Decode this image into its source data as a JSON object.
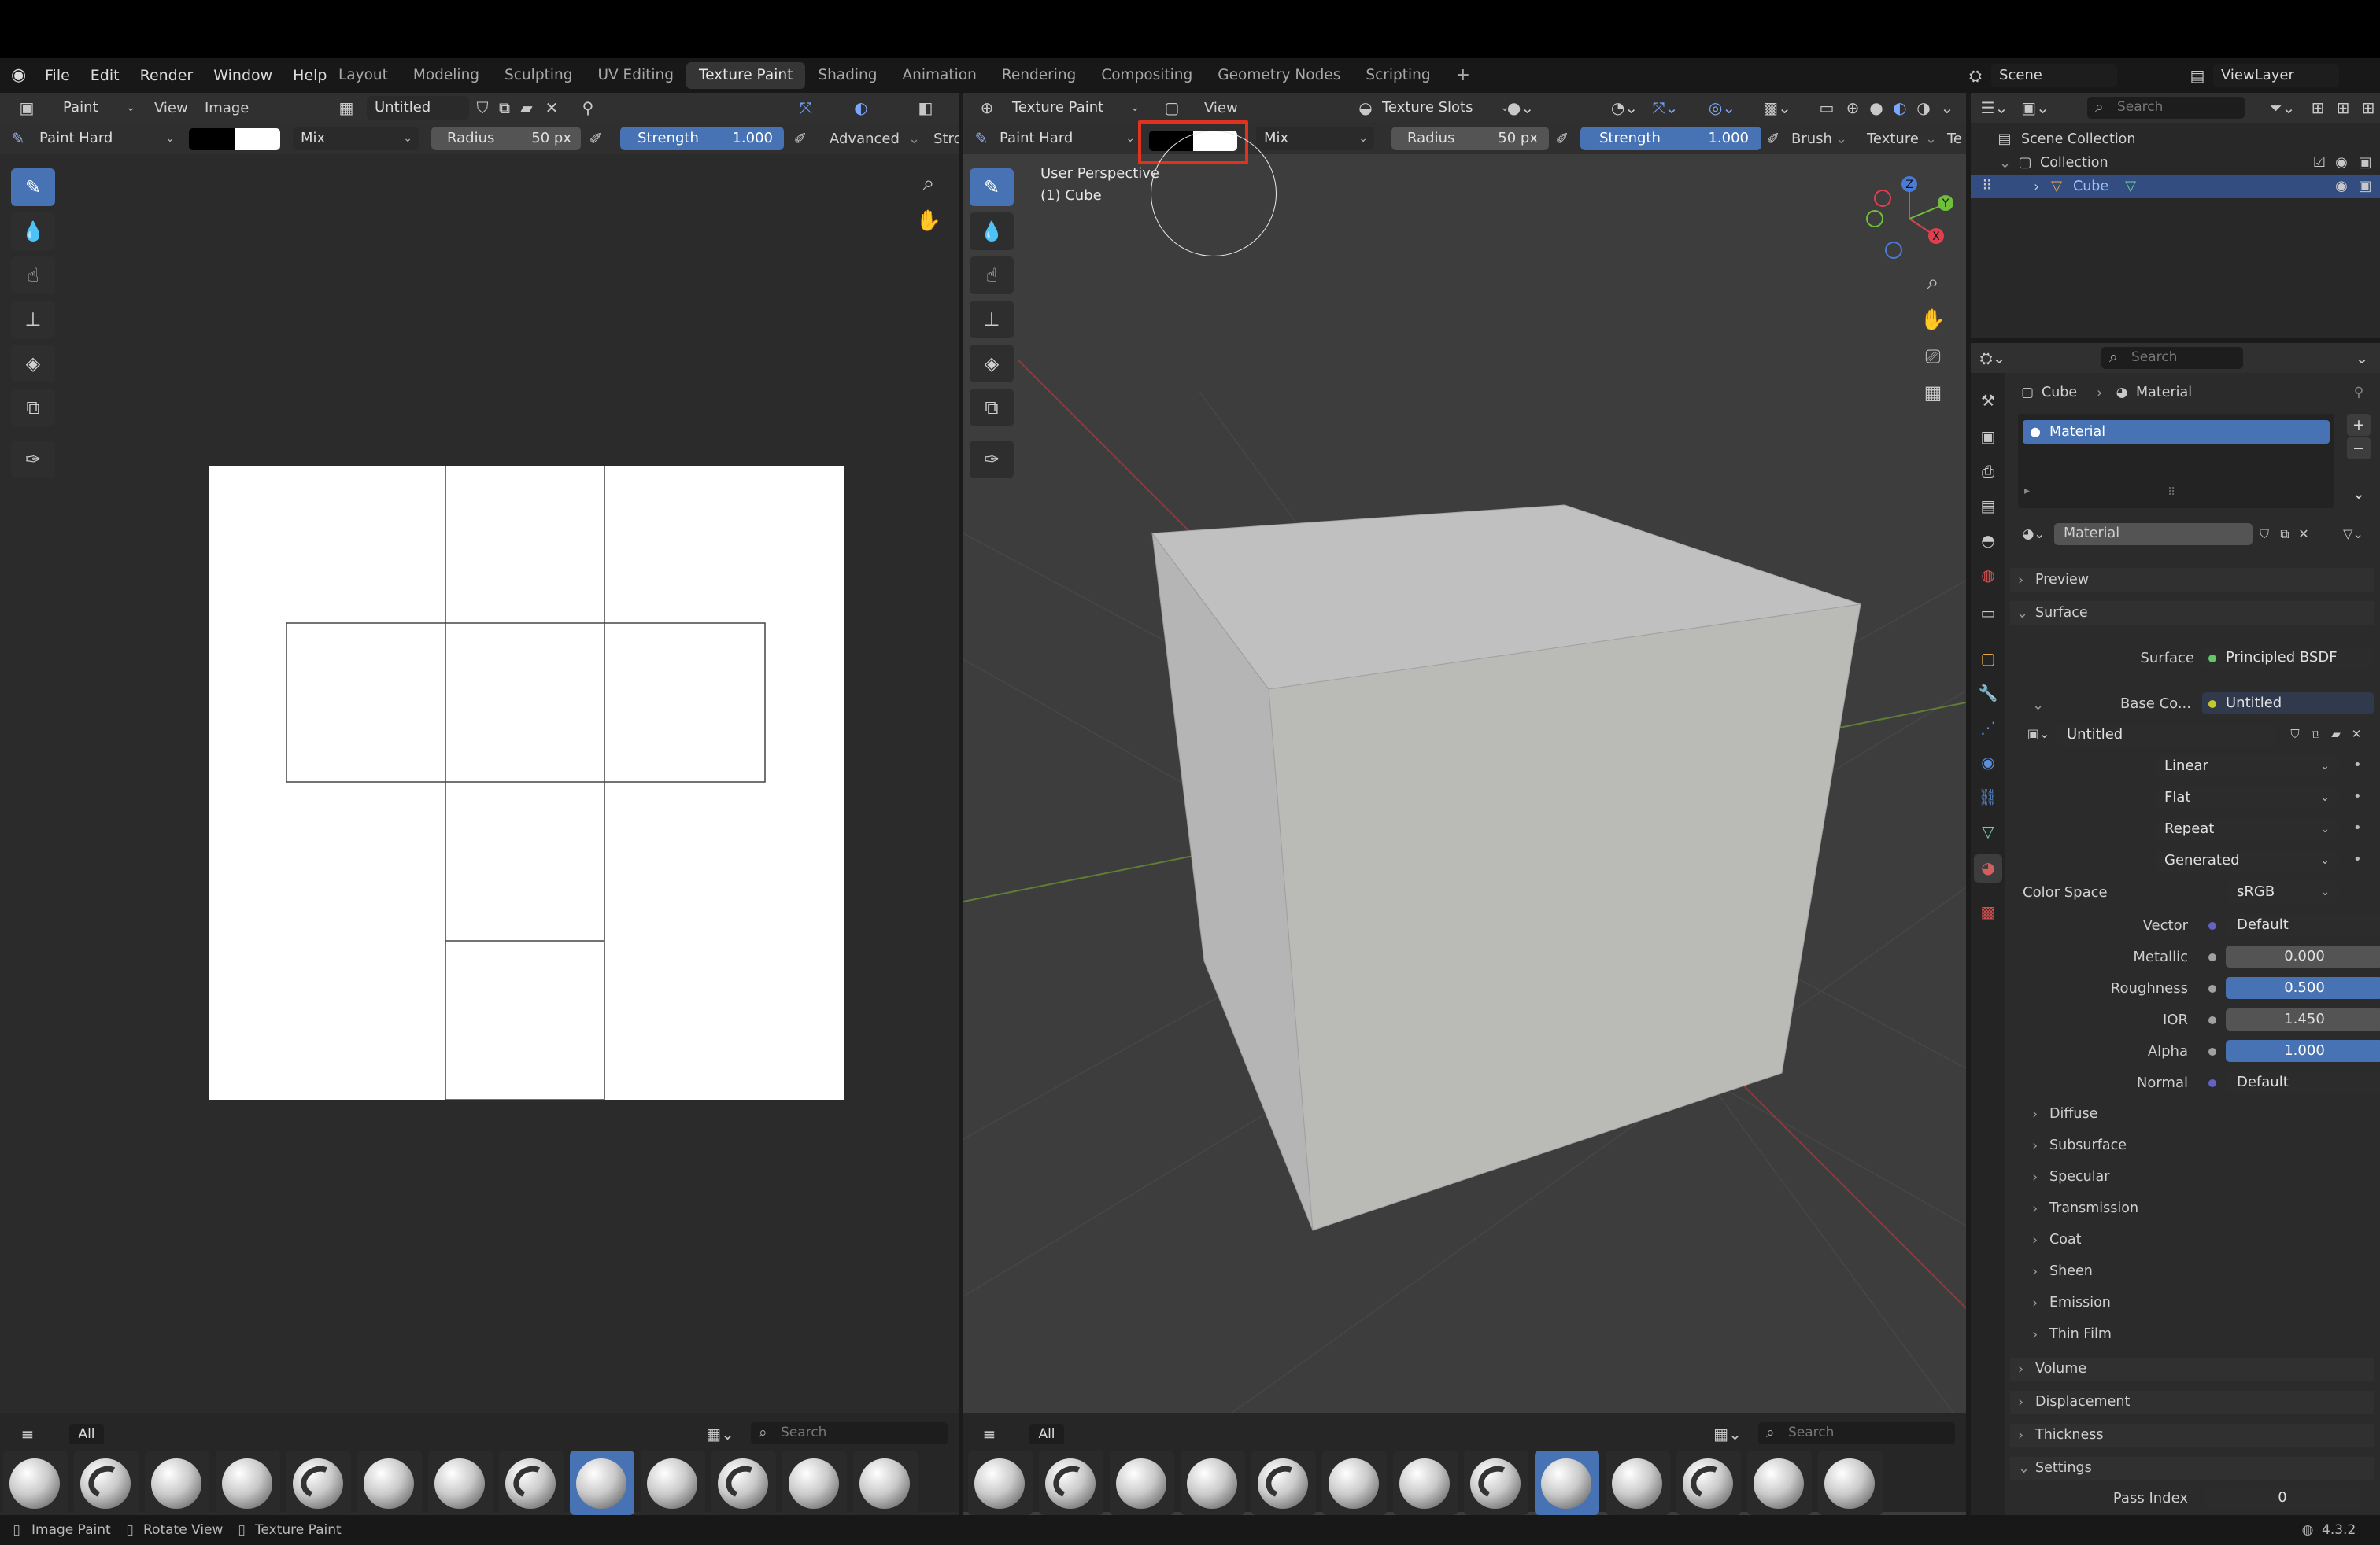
{
  "topmenu": {
    "items": [
      "File",
      "Edit",
      "Render",
      "Window",
      "Help"
    ]
  },
  "workspaces": {
    "tabs": [
      "Layout",
      "Modeling",
      "Sculpting",
      "UV Editing",
      "Texture Paint",
      "Shading",
      "Animation",
      "Rendering",
      "Compositing",
      "Geometry Nodes",
      "Scripting"
    ],
    "active": "Texture Paint"
  },
  "scene": {
    "name": "Scene",
    "view_layer": "ViewLayer"
  },
  "image_editor": {
    "mode": "Paint",
    "view_menu": "View",
    "image_menu": "Image",
    "image_name": "Untitled",
    "brush": "Paint Hard",
    "blend": "Mix",
    "radius_label": "Radius",
    "radius_value": "50 px",
    "strength_label": "Strength",
    "strength_value": "1.000",
    "advanced": "Advanced",
    "stroke_trunc": "Stro",
    "brush_filter": "All",
    "search_placeholder": "Search"
  },
  "viewport": {
    "mode": "Texture Paint",
    "view_menu": "View",
    "texture_slots": "Texture Slots",
    "brush": "Paint Hard",
    "blend": "Mix",
    "radius_label": "Radius",
    "radius_value": "50 px",
    "strength_label": "Strength",
    "strength_value": "1.000",
    "brush_menu": "Brush",
    "texture_menu": "Texture",
    "trunc": "Te",
    "perspective": "User Perspective",
    "object": "(1) Cube",
    "brush_filter": "All",
    "search_placeholder": "Search",
    "gizmo": {
      "z": "Z",
      "y": "Y",
      "x": "X"
    }
  },
  "outliner": {
    "search_placeholder": "Search",
    "scene_collection": "Scene Collection",
    "collection": "Collection",
    "object": "Cube"
  },
  "properties": {
    "search_placeholder": "Search",
    "breadcrumb": [
      "Cube",
      "Material"
    ],
    "slot": "Material",
    "material_name": "Material",
    "panels": {
      "preview": "Preview",
      "surface": "Surface"
    },
    "surface_label": "Surface",
    "surface_value": "Principled BSDF",
    "base_color_label": "Base Co...",
    "base_color_value": "Untitled",
    "image_name": "Untitled",
    "interpolation": "Linear",
    "projection": "Flat",
    "extension": "Repeat",
    "source": "Generated",
    "color_space_label": "Color Space",
    "color_space_value": "sRGB",
    "vector_label": "Vector",
    "vector_value": "Default",
    "metallic_label": "Metallic",
    "metallic_value": "0.000",
    "roughness_label": "Roughness",
    "roughness_value": "0.500",
    "ior_label": "IOR",
    "ior_value": "1.450",
    "alpha_label": "Alpha",
    "alpha_value": "1.000",
    "normal_label": "Normal",
    "normal_value": "Default",
    "subpanels": [
      "Diffuse",
      "Subsurface",
      "Specular",
      "Transmission",
      "Coat",
      "Sheen",
      "Emission",
      "Thin Film"
    ],
    "sections": [
      "Volume",
      "Displacement",
      "Thickness",
      "Settings"
    ],
    "pass_index_label": "Pass Index",
    "pass_index_value": "0"
  },
  "statusbar": {
    "image_paint": "Image Paint",
    "rotate_view": "Rotate View",
    "texture_paint": "Texture Paint",
    "version": "4.3.2"
  },
  "colors": {
    "accent": "#4772b3",
    "highlight_box": "#e0321e",
    "background": "#303030",
    "viewport": "#3d3d3d"
  }
}
